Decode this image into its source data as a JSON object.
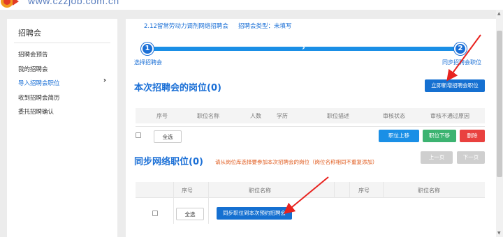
{
  "site": {
    "url": "www.czzjob.com.cn"
  },
  "sidebar": {
    "title": "招聘会",
    "items": [
      {
        "label": "招聘会预告"
      },
      {
        "label": "我的招聘会"
      },
      {
        "label": "导入招聘会职位"
      },
      {
        "label": "收到招聘会简历"
      },
      {
        "label": "委托招聘确认"
      }
    ],
    "active_arrow": "›"
  },
  "breadcrumb": {
    "fair_name": "2.12留常劳动力调剂网络招聘会",
    "fair_type": "招聘会类型：未填写"
  },
  "steps": [
    {
      "number": "1",
      "label": "选择招聘会"
    },
    {
      "number": "2",
      "label": "同步招聘会职位"
    }
  ],
  "section1": {
    "title": "本次招聘会的岗位(0)",
    "add_button": "立即新增招聘会职位",
    "columns": [
      "序号",
      "职位名称",
      "人数",
      "学历",
      "职位描述",
      "审核状态",
      "审核不通过原因"
    ],
    "select_all": "全选",
    "move_up": "职位上移",
    "move_down": "职位下移",
    "delete": "删除"
  },
  "section2": {
    "title": "同步网络职位(0)",
    "hint": "请从岗位库选择要参加本次招聘会的岗位（岗位名称相同不重复添加）",
    "prev_page": "上一页",
    "next_page": "下一页",
    "columns_left": [
      "序号",
      "职位名称"
    ],
    "columns_right": [
      "序号",
      "职位名称"
    ],
    "select_all": "全选",
    "sync_button": "同步职位到本次预约招聘会"
  },
  "colors": {
    "accent": "#1a6fd6",
    "progress": "#1a8fe6",
    "green": "#3cb371",
    "red": "#e9413f",
    "hint": "#e05a1c",
    "annotation_arrow": "#e8231f"
  }
}
